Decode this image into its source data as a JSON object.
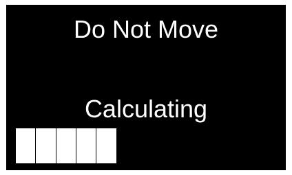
{
  "screen": {
    "title": "Do Not Move",
    "status": "Calculating",
    "progress": {
      "filled_segments": 5,
      "total_segments": 13,
      "fraction": 0.38
    },
    "colors": {
      "background": "#000000",
      "foreground": "#ffffff"
    }
  }
}
